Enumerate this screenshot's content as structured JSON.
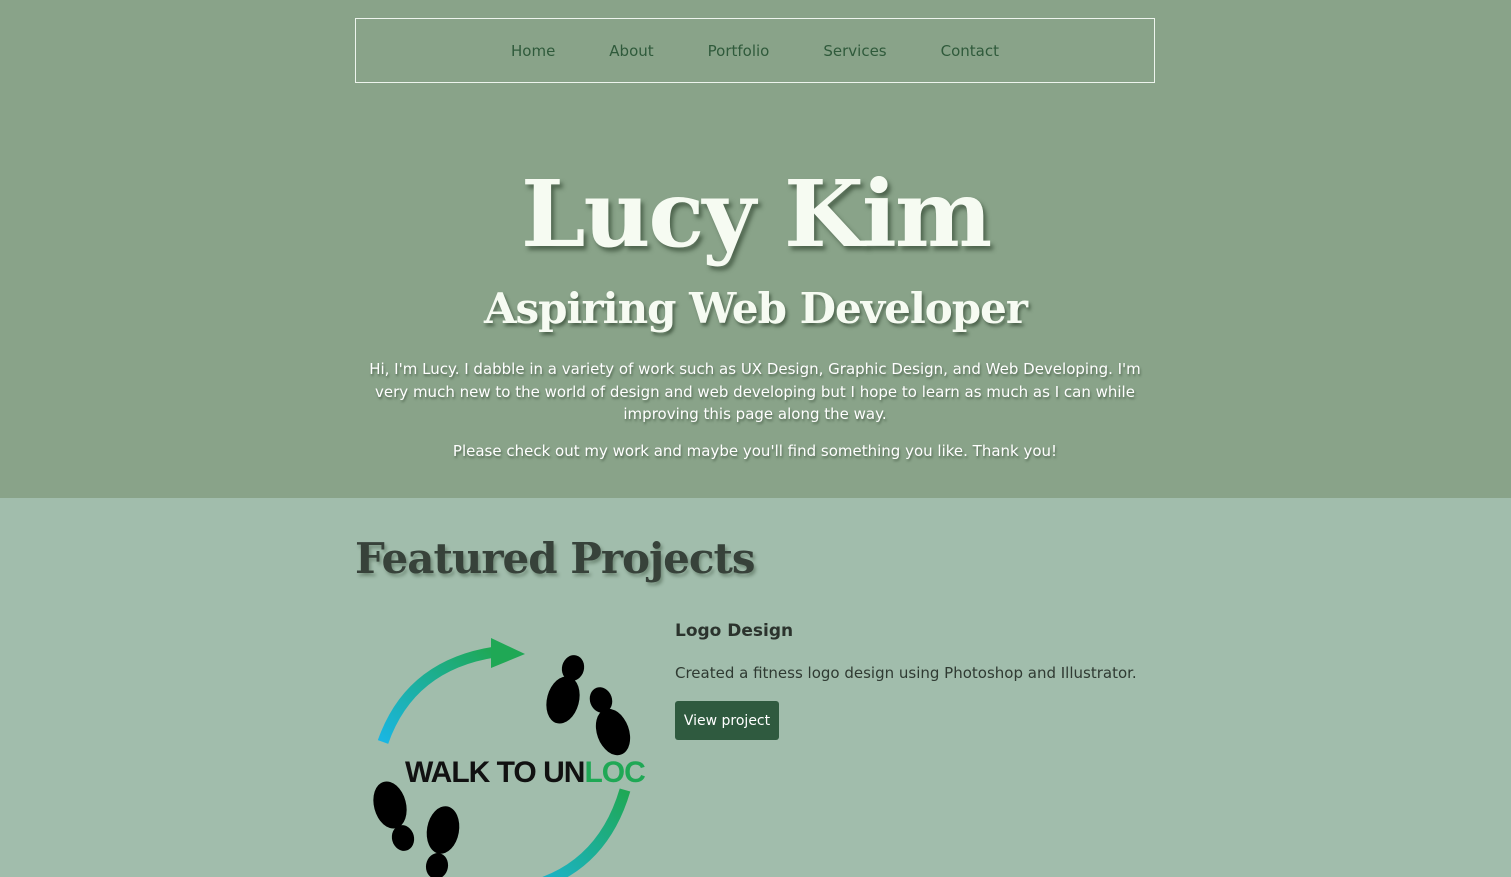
{
  "nav": {
    "items": [
      {
        "label": "Home"
      },
      {
        "label": "About"
      },
      {
        "label": "Portfolio"
      },
      {
        "label": "Services"
      },
      {
        "label": "Contact"
      }
    ]
  },
  "hero": {
    "title": "Lucy Kim",
    "subtitle": "Aspiring Web Developer",
    "intro": "Hi, I'm Lucy. I dabble in a variety of work such as UX Design, Graphic Design, and Web Developing. I'm very much new to the world of design and web developing but I hope to learn as much as I can while improving this page along the way.",
    "thanks": "Please check out my work and maybe you'll find something you like. Thank you!"
  },
  "featured": {
    "heading": "Featured Projects",
    "projects": [
      {
        "title": "Logo Design",
        "description": "Created a fitness logo design using Photoshop and Illustrator.",
        "button_label": "View project",
        "logo_text_dark": "WALK TO UN",
        "logo_text_green": "LOCK"
      }
    ]
  },
  "colors": {
    "hero_bg": "#89a389",
    "featured_bg": "#a1bdac",
    "nav_text": "#2f5a3b",
    "button_bg": "#2f5a3f",
    "logo_green": "#1fa855",
    "logo_blue": "#1ab6e3"
  }
}
